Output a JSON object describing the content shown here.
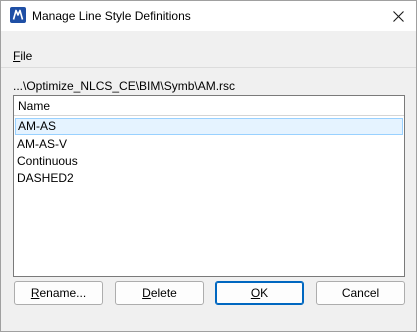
{
  "window": {
    "title": "Manage Line Style Definitions"
  },
  "menu": {
    "file_accel": "F",
    "file_rest": "ile"
  },
  "path": "...\\Optimize_NLCS_CE\\BIM\\Symb\\AM.rsc",
  "list": {
    "column_header": "Name",
    "items": [
      "AM-AS",
      "AM-AS-V",
      "Continuous",
      "DASHED2"
    ],
    "selected_index": 0
  },
  "buttons": {
    "rename": {
      "accel": "R",
      "rest": "ename..."
    },
    "delete": {
      "accel": "D",
      "rest": "elete"
    },
    "ok": {
      "accel": "O",
      "rest": "K"
    },
    "cancel": {
      "label": "Cancel"
    }
  },
  "colors": {
    "selection_fill": "#e5f3ff",
    "selection_border": "#99d1ff",
    "default_button_border": "#0067c0",
    "app_icon": "#1f4fa5"
  },
  "icons": {
    "app": "microstation-app-icon",
    "close": "close-icon"
  }
}
